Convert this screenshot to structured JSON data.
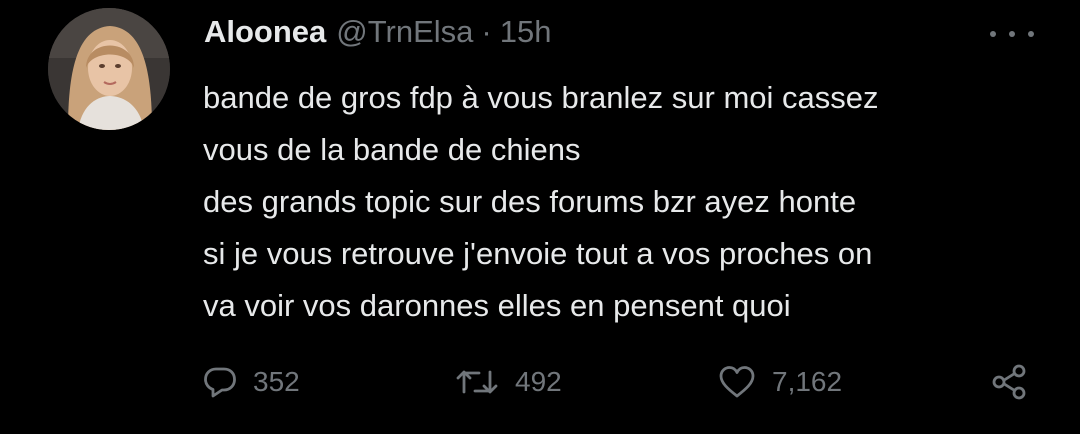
{
  "tweet": {
    "author": {
      "display_name": "Aloonea",
      "handle": "@TrnElsa",
      "separator": "·",
      "time": "15h"
    },
    "text_lines": [
      "bande de gros fdp à vous branlez sur moi cassez",
      "vous de la bande de chiens",
      "des grands topic sur des forums bzr ayez honte",
      "si je vous retrouve j'envoie tout a vos proches on",
      "va voir vos daronnes elles en pensent quoi"
    ],
    "stats": {
      "replies": "352",
      "retweets": "492",
      "likes": "7,162"
    },
    "icons": {
      "more": "more-horizontal-icon",
      "reply": "reply-icon",
      "retweet": "retweet-icon",
      "like": "heart-icon",
      "share": "share-icon"
    }
  },
  "colors": {
    "background": "#000000",
    "primary_text": "#e7e9ea",
    "secondary_text": "#71767b"
  }
}
